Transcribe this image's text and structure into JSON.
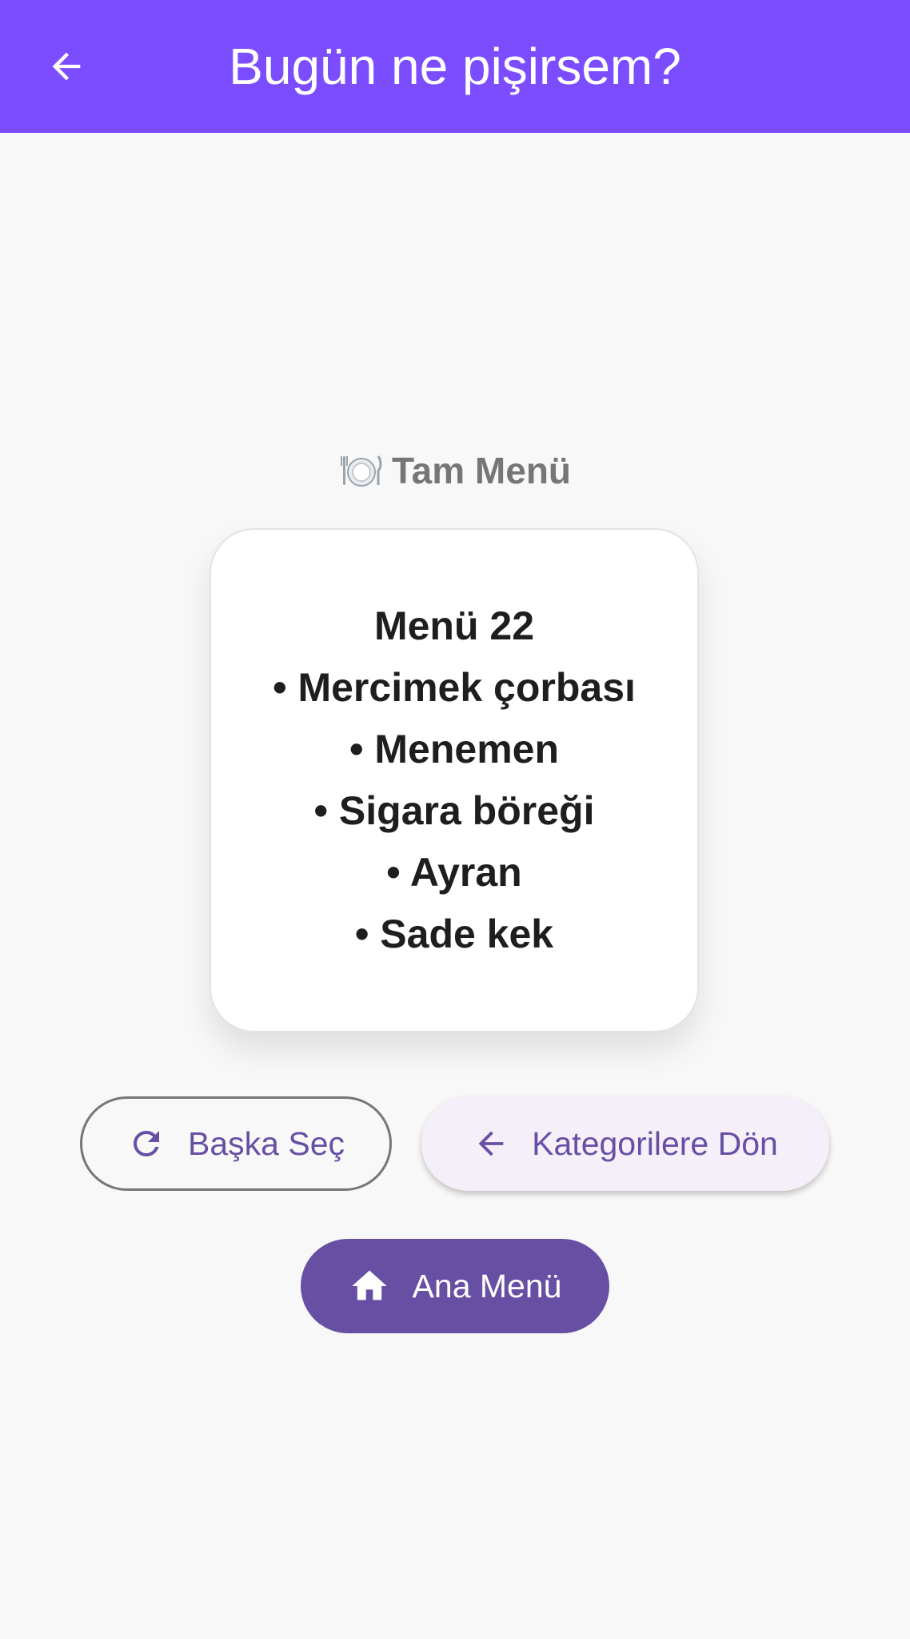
{
  "app_bar": {
    "title": "Bugün ne pişirsem?",
    "back_icon": "arrow-back-icon",
    "background": "#7c4dff"
  },
  "section": {
    "icon": "plate-cutlery-icon",
    "title": "Tam Menü"
  },
  "menu_card": {
    "lines": [
      "Menü 22",
      "• Mercimek çorbası",
      "• Menemen",
      "• Sigara böreği",
      "• Ayran",
      "• Sade kek"
    ]
  },
  "buttons": {
    "pick_another": {
      "label": "Başka Seç",
      "icon": "refresh-icon"
    },
    "back_to_categories": {
      "label": "Kategorilere Dön",
      "icon": "arrow-back-icon"
    },
    "main_menu": {
      "label": "Ana Menü",
      "icon": "home-icon"
    }
  },
  "colors": {
    "primary": "#6750a4",
    "app_bar": "#7c4dff",
    "background": "#f8f8f8"
  }
}
